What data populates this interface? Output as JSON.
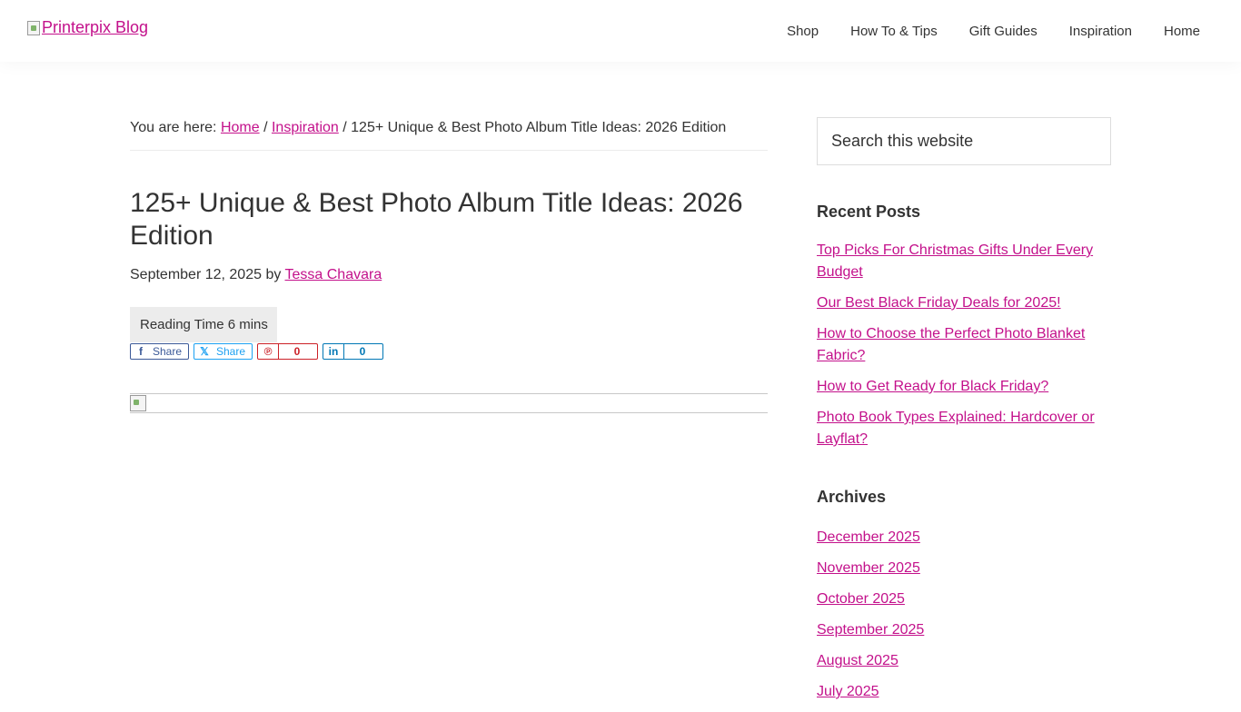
{
  "header": {
    "logo_alt": "Printerpix Blog",
    "nav": [
      "Shop",
      "How To & Tips",
      "Gift Guides",
      "Inspiration",
      "Home"
    ]
  },
  "breadcrumb": {
    "prefix": "You are here: ",
    "home": "Home",
    "sep1": " / ",
    "category": "Inspiration",
    "sep2": " / ",
    "current": "125+ Unique & Best Photo Album Title Ideas: 2026 Edition"
  },
  "article": {
    "title": "125+ Unique & Best Photo Album Title Ideas: 2026 Edition",
    "date": "September 12, 2025",
    "by": " by ",
    "author": "Tessa Chavara",
    "reading_time": "Reading Time 6 mins"
  },
  "share": {
    "facebook_label": "Share",
    "twitter_label": "Share",
    "pinterest_count": "0",
    "linkedin_count": "0"
  },
  "sidebar": {
    "search_placeholder": "Search this website",
    "recent_title": "Recent Posts",
    "recent_posts": [
      "Top Picks For Christmas Gifts Under Every Budget",
      "Our Best Black Friday Deals for 2025!",
      "How to Choose the Perfect Photo Blanket Fabric?",
      "How to Get Ready for Black Friday?",
      "Photo Book Types Explained: Hardcover or Layflat?"
    ],
    "archives_title": "Archives",
    "archives": [
      "December 2025",
      "November 2025",
      "October 2025",
      "September 2025",
      "August 2025",
      "July 2025"
    ]
  },
  "colors": {
    "link": "#c3118b",
    "text": "#333333",
    "facebook": "#3b5998",
    "twitter": "#1da1f2",
    "pinterest": "#cb2027",
    "linkedin": "#0077b5"
  }
}
